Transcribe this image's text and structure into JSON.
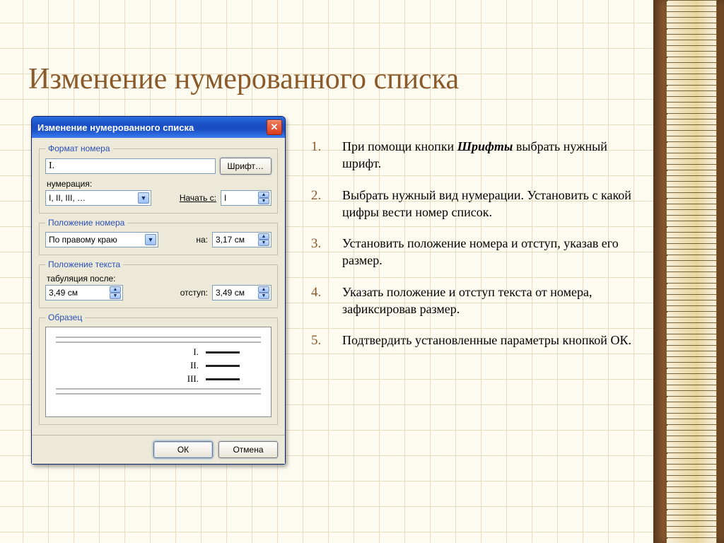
{
  "slide": {
    "title": "Изменение нумерованного списка"
  },
  "steps": [
    {
      "num": "1.",
      "text_a": "При помощи кнопки ",
      "bold": "Шрифты",
      "text_b": " выбрать нужный шрифт."
    },
    {
      "num": "2.",
      "text_a": "Выбрать нужный вид нумерации. Установить с какой цифры вести номер список.",
      "bold": "",
      "text_b": ""
    },
    {
      "num": "3.",
      "text_a": "Установить положение номера и отступ, указав его размер.",
      "bold": "",
      "text_b": ""
    },
    {
      "num": "4.",
      "text_a": "Указать положение и отступ текста от номера, зафиксировав размер.",
      "bold": "",
      "text_b": ""
    },
    {
      "num": "5.",
      "text_a": "Подтвердить установленные параметры кнопкой ОК.",
      "bold": "",
      "text_b": ""
    }
  ],
  "dialog": {
    "title": "Изменение нумерованного списка",
    "group_format": "Формат номера",
    "format_value": "I.",
    "font_button": "Шрифт…",
    "numbering_label": "нумерация:",
    "numbering_value": "I, II, III, …",
    "start_label": "Начать с:",
    "start_value": "I",
    "group_pos_number": "Положение номера",
    "align_value": "По правому краю",
    "at_label": "на:",
    "at_value": "3,17 см",
    "group_pos_text": "Положение текста",
    "tab_after_label": "табуляция после:",
    "tab_after_value": "3,49 см",
    "indent_label": "отступ:",
    "indent_value": "3,49 см",
    "group_preview": "Образец",
    "preview_items": [
      "I.",
      "II.",
      "III."
    ],
    "ok": "ОК",
    "cancel": "Отмена"
  }
}
